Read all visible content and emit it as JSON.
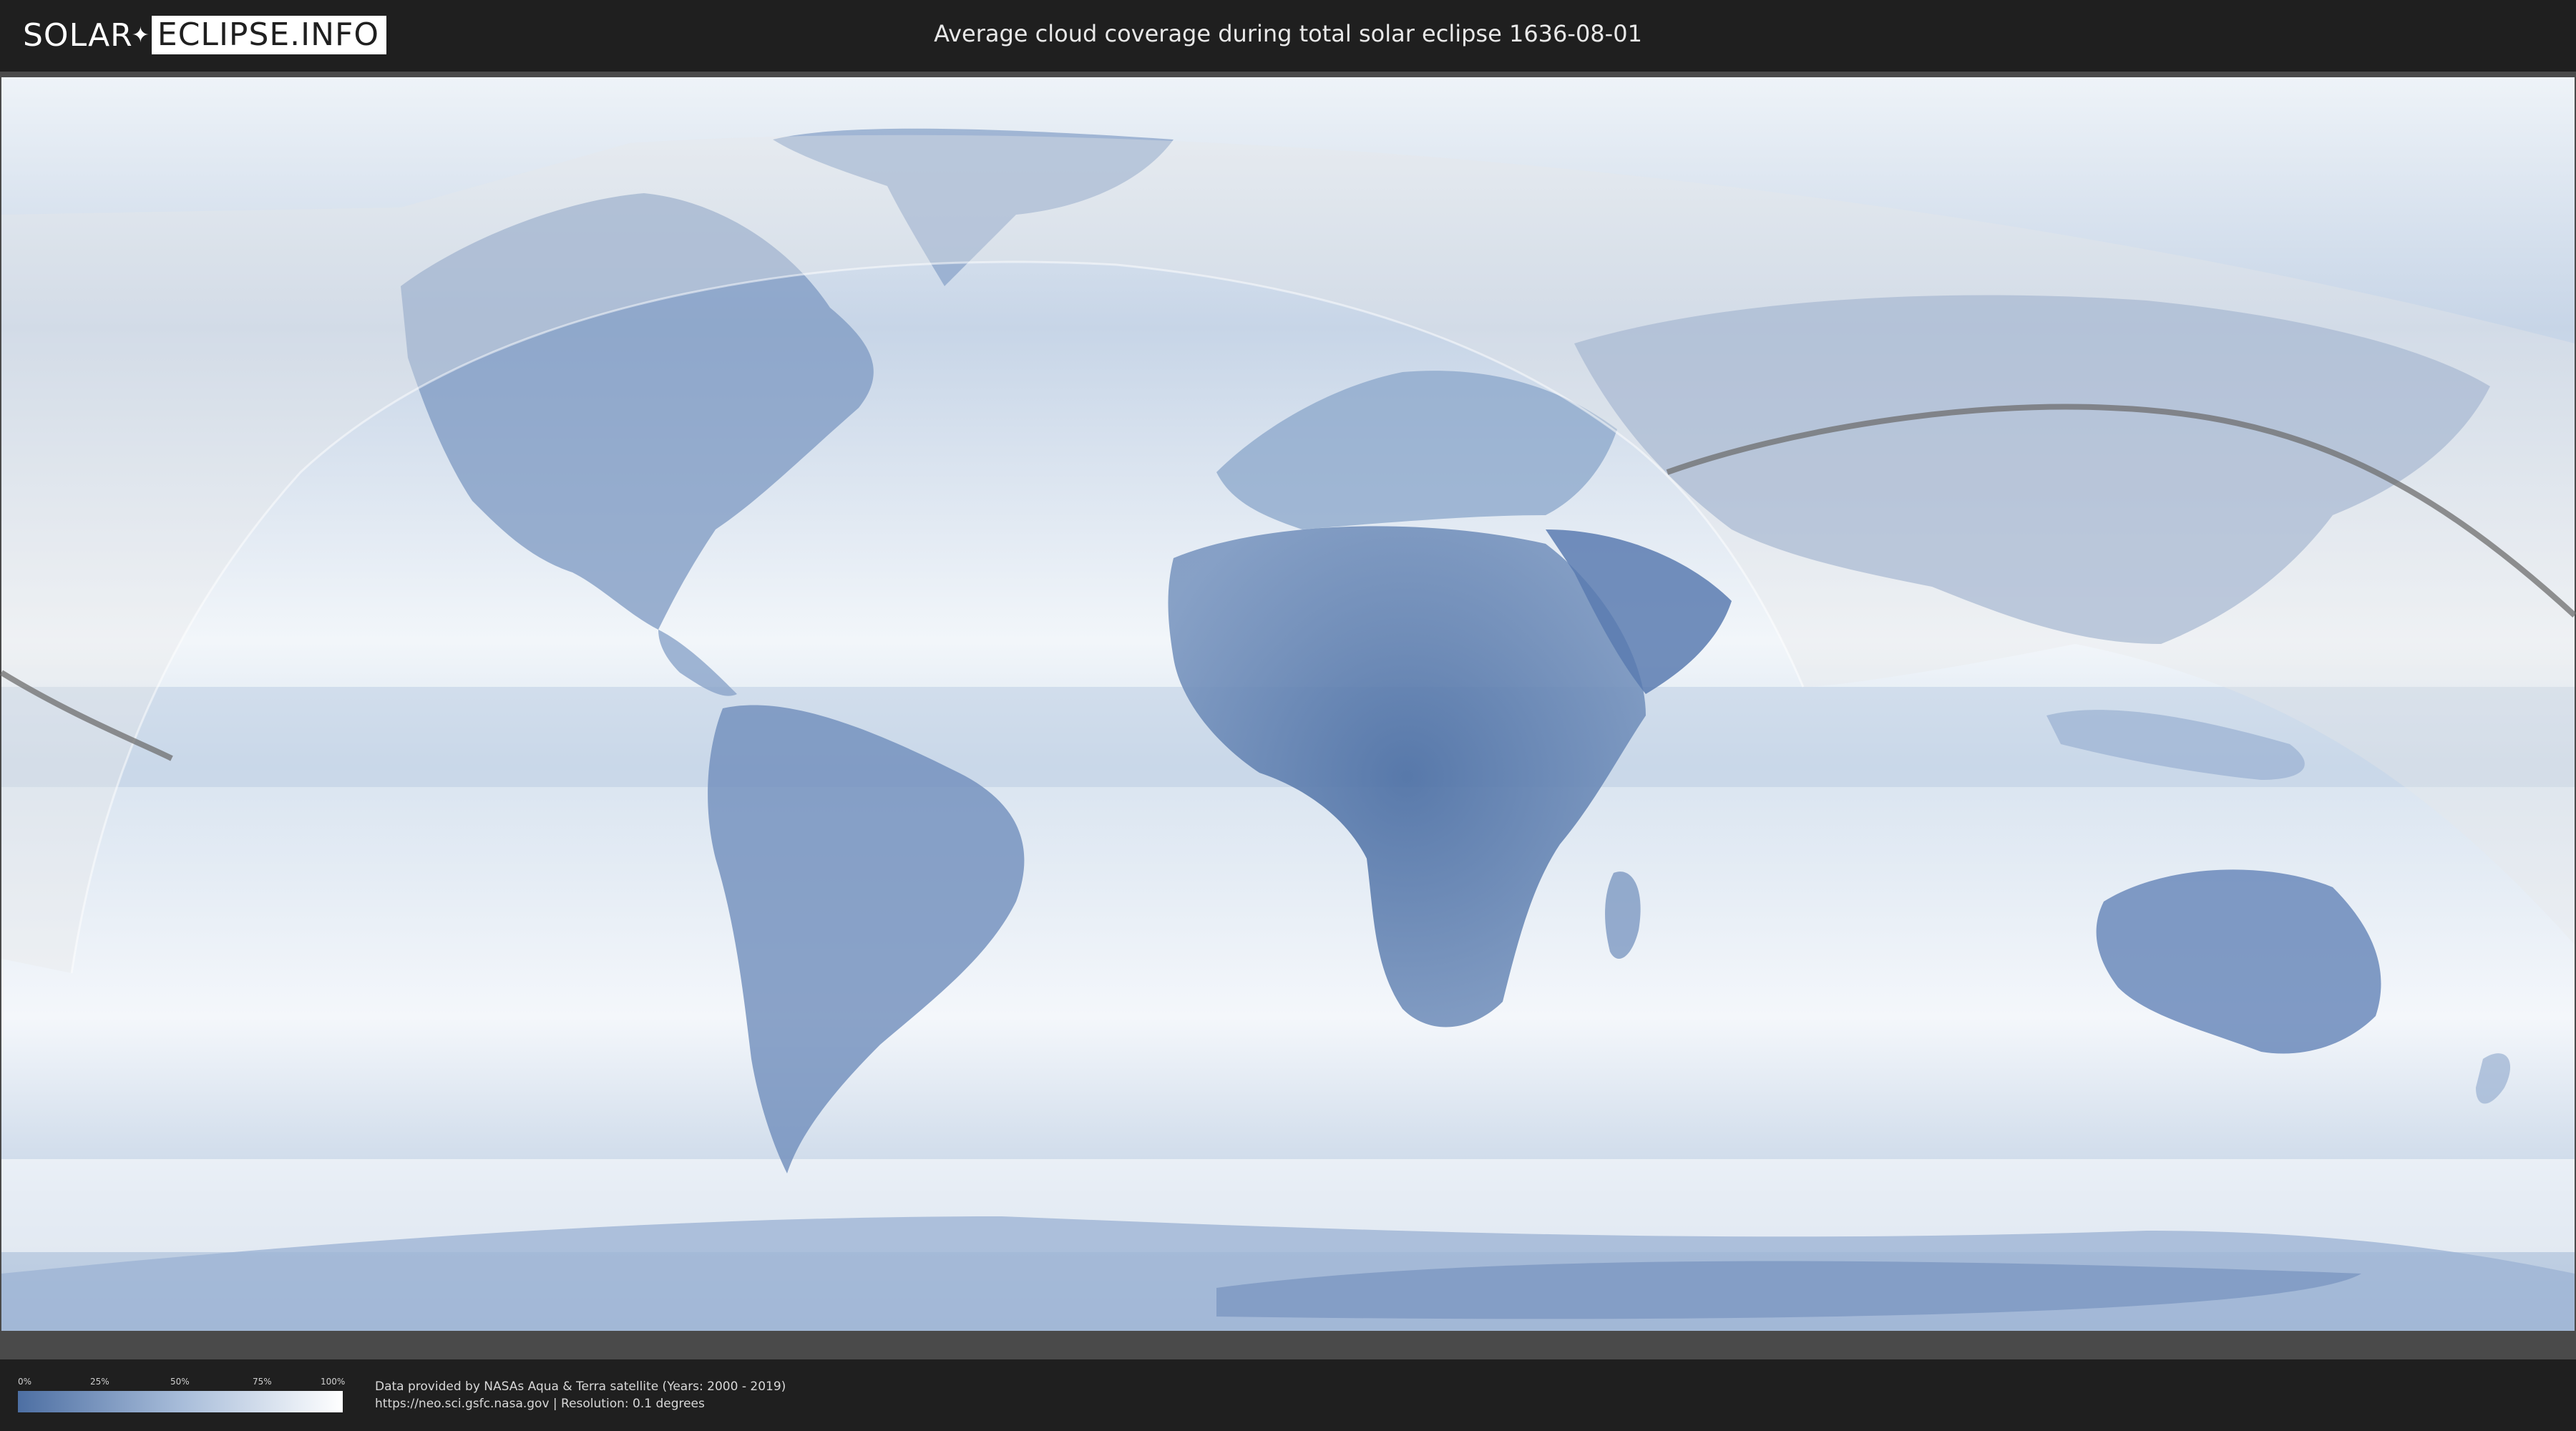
{
  "header": {
    "logo_part1": "SOLAR",
    "logo_part2": "ECLIPSE.INFO",
    "title": "Average cloud coverage during total solar eclipse 1636-08-01"
  },
  "legend": {
    "ticks": [
      "0%",
      "25%",
      "50%",
      "75%",
      "100%"
    ],
    "colors": {
      "low": "#4d6fa3",
      "mid": "#a7bcd9",
      "high": "#ffffff"
    }
  },
  "footer": {
    "credit_line1": "Data provided by NASAs Aqua & Terra satellite (Years: 2000 - 2019)",
    "credit_line2": "https://neo.sci.gsfc.nasa.gov | Resolution: 0.1 degrees"
  },
  "map": {
    "colors": {
      "ocean": "#dfe8f3",
      "clear_sky": "#4f72a6",
      "shadow_overlay": "#e8e8e8",
      "eclipse_path": "#6e6e6e"
    }
  }
}
